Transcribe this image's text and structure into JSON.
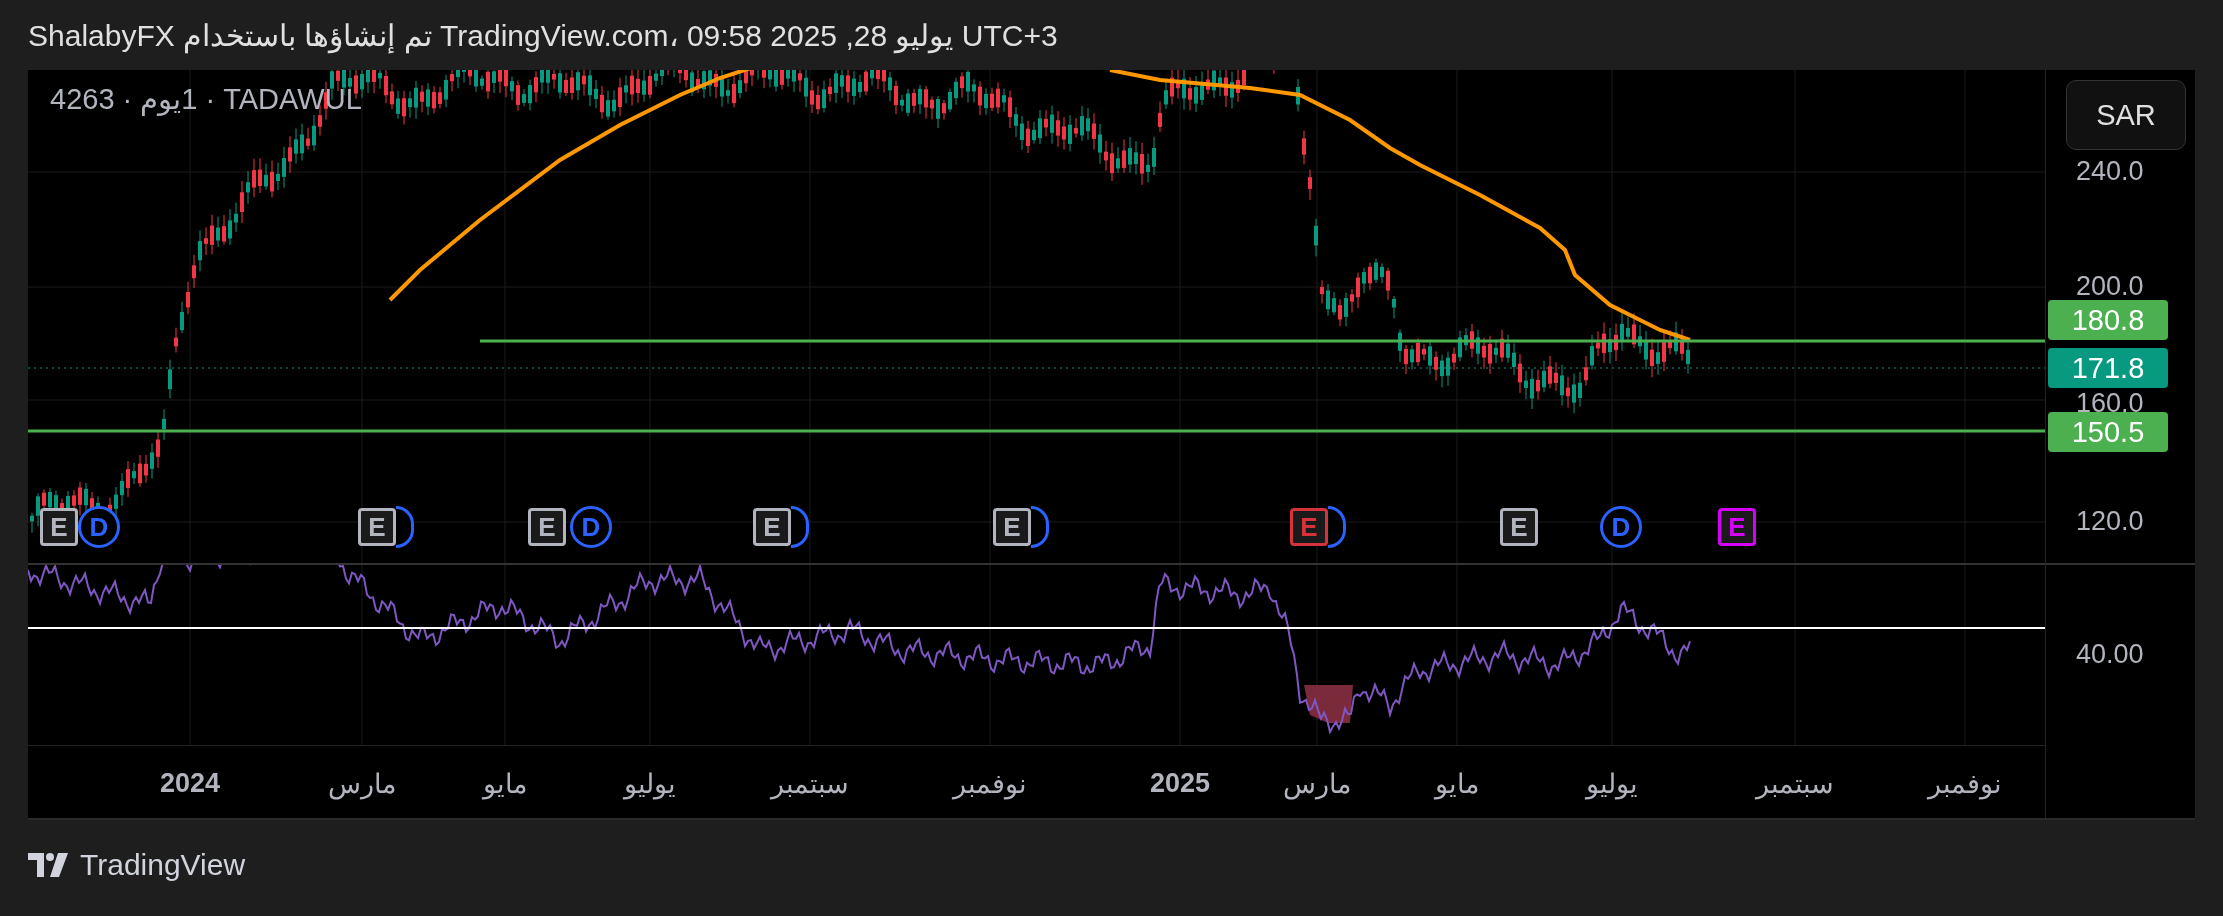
{
  "header": {
    "text": "ShalabyFX تم إنشاؤها باستخدام TradingView.com، يوليو 28, 2025 09:58 UTC+3"
  },
  "symbol": {
    "text": "TADAWUL · ‏1يوم · 4263"
  },
  "currency_button": {
    "label": "SAR"
  },
  "price_axis": {
    "ticks": [
      "240.0",
      "200.0",
      "160.0",
      "120.0"
    ]
  },
  "price_tags": [
    {
      "value": "180.8",
      "color": "#4caf50"
    },
    {
      "value": "171.8",
      "color": "#089981"
    },
    {
      "value": "150.5",
      "color": "#4caf50"
    }
  ],
  "events": [
    {
      "kind": "earnings",
      "label": "E",
      "color": "#d500f9"
    },
    {
      "kind": "dividend",
      "label": "D",
      "color": "#2962ff"
    },
    {
      "kind": "earnings",
      "label": "E",
      "color": "#b2b5be"
    },
    {
      "kind": "dividend",
      "color": "#2962ff"
    },
    {
      "kind": "earnings",
      "label": "E",
      "color": "#d5323c"
    },
    {
      "kind": "dividend",
      "color": "#2962ff"
    },
    {
      "kind": "earnings",
      "label": "E",
      "color": "#b2b5be"
    },
    {
      "kind": "dividend",
      "color": "#2962ff"
    },
    {
      "kind": "earnings",
      "label": "E",
      "color": "#b2b5be"
    },
    {
      "kind": "dividend",
      "label": "D",
      "color": "#2962ff"
    },
    {
      "kind": "earnings",
      "label": "E",
      "color": "#b2b5be"
    },
    {
      "kind": "dividend",
      "color": "#2962ff"
    },
    {
      "kind": "earnings",
      "label": "E",
      "color": "#b2b5be"
    },
    {
      "kind": "dividend",
      "label": "D",
      "color": "#2962ff"
    },
    {
      "kind": "earnings",
      "label": "E",
      "color": "#b2b5be"
    }
  ],
  "rsi_axis": {
    "ticks": [
      "40.00"
    ]
  },
  "time_axis": {
    "labels": [
      {
        "text": "نوفمبر",
        "bold": false
      },
      {
        "text": "سبتمبر",
        "bold": false
      },
      {
        "text": "يوليو",
        "bold": false
      },
      {
        "text": "مايو",
        "bold": false
      },
      {
        "text": "مارس",
        "bold": false
      },
      {
        "text": "2025",
        "bold": true
      },
      {
        "text": "نوفمبر",
        "bold": false
      },
      {
        "text": "سبتمبر",
        "bold": false
      },
      {
        "text": "يوليو",
        "bold": false
      },
      {
        "text": "مايو",
        "bold": false
      },
      {
        "text": "مارس",
        "bold": false
      },
      {
        "text": "2024",
        "bold": true
      }
    ]
  },
  "footer": {
    "brand": "TradingView"
  }
}
